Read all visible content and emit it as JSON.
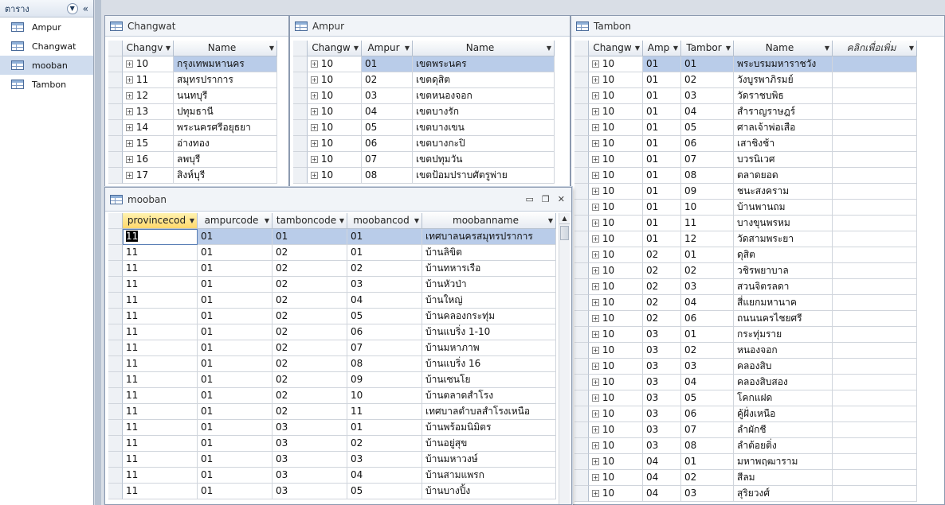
{
  "nav": {
    "title": "ตาราง",
    "items": [
      {
        "label": "Ampur",
        "selected": false
      },
      {
        "label": "Changwat",
        "selected": false
      },
      {
        "label": "mooban",
        "selected": true
      },
      {
        "label": "Tambon",
        "selected": false
      }
    ]
  },
  "windows": {
    "changwat": {
      "title": "Changwat",
      "columns": [
        "Changv",
        "Name"
      ],
      "rows": [
        [
          "10",
          "กรุงเทพมหานคร"
        ],
        [
          "11",
          "สมุทรปราการ"
        ],
        [
          "12",
          "นนทบุรี"
        ],
        [
          "13",
          "ปทุมธานี"
        ],
        [
          "14",
          "พระนครศรีอยุธยา"
        ],
        [
          "15",
          "อ่างทอง"
        ],
        [
          "16",
          "ลพบุรี"
        ],
        [
          "17",
          "สิงห์บุรี"
        ]
      ]
    },
    "ampur": {
      "title": "Ampur",
      "columns": [
        "Changw",
        "Ampur",
        "Name"
      ],
      "rows": [
        [
          "10",
          "01",
          "เขตพระนคร"
        ],
        [
          "10",
          "02",
          "เขตดุสิต"
        ],
        [
          "10",
          "03",
          "เขตหนองจอก"
        ],
        [
          "10",
          "04",
          "เขตบางรัก"
        ],
        [
          "10",
          "05",
          "เขตบางเขน"
        ],
        [
          "10",
          "06",
          "เขตบางกะปิ"
        ],
        [
          "10",
          "07",
          "เขตปทุมวัน"
        ],
        [
          "10",
          "08",
          "เขตป้อมปราบศัตรูพ่าย"
        ]
      ]
    },
    "tambon": {
      "title": "Tambon",
      "columns": [
        "Changw",
        "Amp",
        "Tambor",
        "Name",
        "คลิกเพื่อเพิ่ม"
      ],
      "rows": [
        [
          "10",
          "01",
          "01",
          "พระบรมมหาราชวัง"
        ],
        [
          "10",
          "01",
          "02",
          "วังบูรพาภิรมย์"
        ],
        [
          "10",
          "01",
          "03",
          "วัดราชบพิธ"
        ],
        [
          "10",
          "01",
          "04",
          "สำราญราษฎร์"
        ],
        [
          "10",
          "01",
          "05",
          "ศาลเจ้าพ่อเสือ"
        ],
        [
          "10",
          "01",
          "06",
          "เสาชิงช้า"
        ],
        [
          "10",
          "01",
          "07",
          "บวรนิเวศ"
        ],
        [
          "10",
          "01",
          "08",
          "ตลาดยอด"
        ],
        [
          "10",
          "01",
          "09",
          "ชนะสงคราม"
        ],
        [
          "10",
          "01",
          "10",
          "บ้านพานถม"
        ],
        [
          "10",
          "01",
          "11",
          "บางขุนพรหม"
        ],
        [
          "10",
          "01",
          "12",
          "วัดสามพระยา"
        ],
        [
          "10",
          "02",
          "01",
          "ดุสิต"
        ],
        [
          "10",
          "02",
          "02",
          "วชิรพยาบาล"
        ],
        [
          "10",
          "02",
          "03",
          "สวนจิตรลดา"
        ],
        [
          "10",
          "02",
          "04",
          "สี่แยกมหานาค"
        ],
        [
          "10",
          "02",
          "06",
          "ถนนนครไชยศรี"
        ],
        [
          "10",
          "03",
          "01",
          "กระทุ่มราย"
        ],
        [
          "10",
          "03",
          "02",
          "หนองจอก"
        ],
        [
          "10",
          "03",
          "03",
          "คลองสิบ"
        ],
        [
          "10",
          "03",
          "04",
          "คลองสิบสอง"
        ],
        [
          "10",
          "03",
          "05",
          "โคกแฝด"
        ],
        [
          "10",
          "03",
          "06",
          "คู้ฝั่งเหนือ"
        ],
        [
          "10",
          "03",
          "07",
          "ลำผักชี"
        ],
        [
          "10",
          "03",
          "08",
          "ลำต้อยติ่ง"
        ],
        [
          "10",
          "04",
          "01",
          "มหาพฤฒาราม"
        ],
        [
          "10",
          "04",
          "02",
          "สีลม"
        ],
        [
          "10",
          "04",
          "03",
          "สุริยวงศ์"
        ]
      ]
    },
    "mooban": {
      "title": "mooban",
      "controls": {
        "minimize": "▭",
        "restore": "❐",
        "close": "✕"
      },
      "columns": [
        "provincecod",
        "ampurcode",
        "tamboncode",
        "moobancod",
        "moobanname"
      ],
      "rows": [
        [
          "11",
          "01",
          "01",
          "01",
          "เทศบาลนครสมุทรปราการ"
        ],
        [
          "11",
          "01",
          "02",
          "01",
          "บ้านลิขิต"
        ],
        [
          "11",
          "01",
          "02",
          "02",
          "บ้านทหารเรือ"
        ],
        [
          "11",
          "01",
          "02",
          "03",
          "บ้านหัวป่า"
        ],
        [
          "11",
          "01",
          "02",
          "04",
          "บ้านใหญ่"
        ],
        [
          "11",
          "01",
          "02",
          "05",
          "บ้านคลองกระทุ่ม"
        ],
        [
          "11",
          "01",
          "02",
          "06",
          "บ้านแบริ่ง 1-10"
        ],
        [
          "11",
          "01",
          "02",
          "07",
          "บ้านมหาภาพ"
        ],
        [
          "11",
          "01",
          "02",
          "08",
          "บ้านแบริ่ง 16"
        ],
        [
          "11",
          "01",
          "02",
          "09",
          "บ้านเซนโย"
        ],
        [
          "11",
          "01",
          "02",
          "10",
          "บ้านตลาดสำโรง"
        ],
        [
          "11",
          "01",
          "02",
          "11",
          "เทศบาลตำบลสำโรงเหนือ"
        ],
        [
          "11",
          "01",
          "03",
          "01",
          "บ้านพร้อมนิมิตร"
        ],
        [
          "11",
          "01",
          "03",
          "02",
          "บ้านอยู่สุข"
        ],
        [
          "11",
          "01",
          "03",
          "03",
          "บ้านมหาวงษ์"
        ],
        [
          "11",
          "01",
          "03",
          "04",
          "บ้านสามแพรก"
        ],
        [
          "11",
          "01",
          "03",
          "05",
          "บ้านบางปิ้ง"
        ]
      ]
    }
  }
}
